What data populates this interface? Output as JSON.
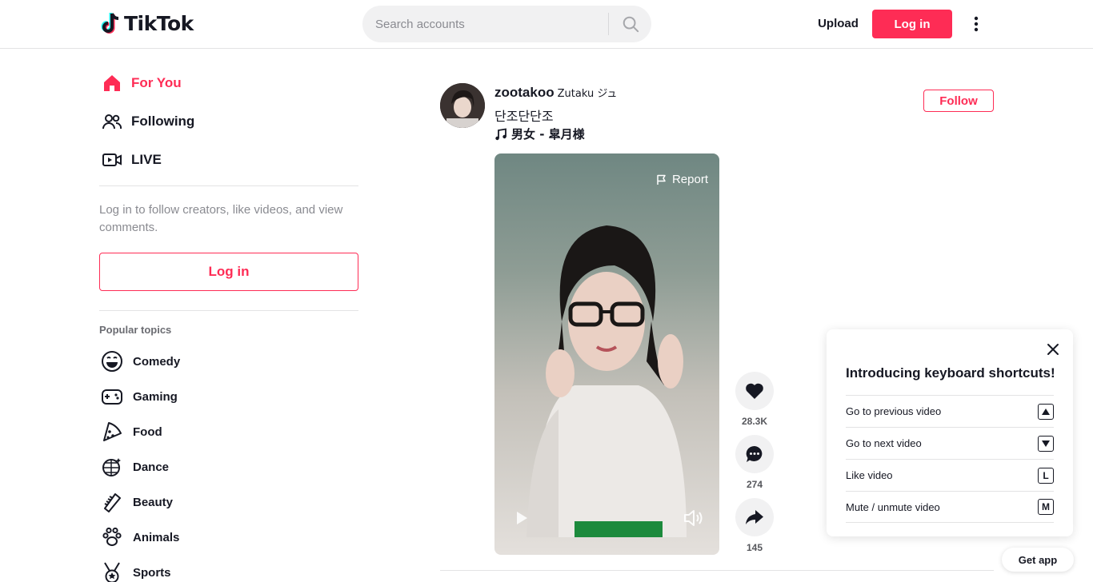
{
  "header": {
    "logo_text": "TikTok",
    "search_placeholder": "Search accounts",
    "upload_label": "Upload",
    "login_label": "Log in"
  },
  "sidebar": {
    "nav": [
      {
        "label": "For You",
        "icon": "home-icon",
        "active": true
      },
      {
        "label": "Following",
        "icon": "users-icon",
        "active": false
      },
      {
        "label": "LIVE",
        "icon": "live-icon",
        "active": false
      }
    ],
    "login_prompt": "Log in to follow creators, like videos, and view comments.",
    "login_label": "Log in",
    "topics_title": "Popular topics",
    "topics": [
      {
        "label": "Comedy",
        "icon": "comedy-icon"
      },
      {
        "label": "Gaming",
        "icon": "gaming-icon"
      },
      {
        "label": "Food",
        "icon": "food-icon"
      },
      {
        "label": "Dance",
        "icon": "dance-icon"
      },
      {
        "label": "Beauty",
        "icon": "beauty-icon"
      },
      {
        "label": "Animals",
        "icon": "animals-icon"
      },
      {
        "label": "Sports",
        "icon": "sports-icon"
      }
    ]
  },
  "post": {
    "username": "zootakoo",
    "nickname": "Zutaku ジュ",
    "caption": "단조단단조",
    "music": "男女 - 皐月様",
    "follow_label": "Follow",
    "report_label": "Report",
    "likes": "28.3K",
    "comments": "274",
    "shares": "145"
  },
  "shortcuts": {
    "title": "Introducing keyboard shortcuts!",
    "items": [
      {
        "label": "Go to previous video",
        "key": "▲"
      },
      {
        "label": "Go to next video",
        "key": "▼"
      },
      {
        "label": "Like video",
        "key": "L"
      },
      {
        "label": "Mute / unmute video",
        "key": "M"
      }
    ]
  },
  "get_app_label": "Get app",
  "colors": {
    "accent": "#fe2c55",
    "text": "#161823",
    "muted": "#8a8b91"
  }
}
